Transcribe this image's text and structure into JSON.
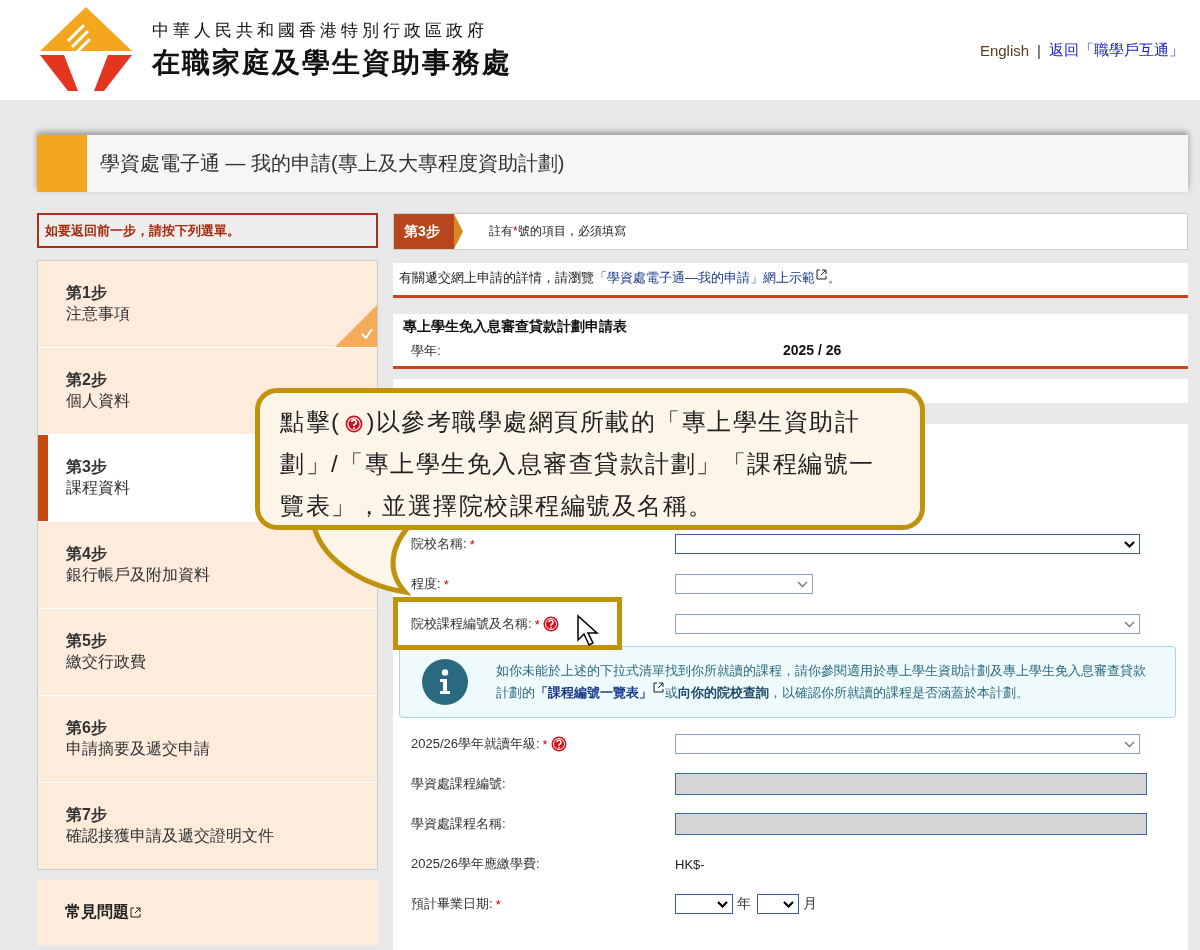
{
  "header": {
    "agency_line1": "中華人民共和國香港特別行政區政府",
    "agency_line2": "在職家庭及學生資助事務處",
    "links": [
      {
        "label": "English",
        "kind": "language"
      },
      {
        "label": "返回「職學戶互通」",
        "kind": "portal"
      }
    ],
    "separator": "|"
  },
  "page_title": "學資處電子通 — 我的申請(專上及大專程度資助計劃)",
  "sidebar": {
    "notice": "如要返回前一步，請按下列選單。",
    "steps": [
      {
        "number": "第1步",
        "title": "注意事項",
        "completed": true,
        "selected": false
      },
      {
        "number": "第2步",
        "title": "個人資料",
        "completed": false,
        "selected": false
      },
      {
        "number": "第3步",
        "title": "課程資料",
        "completed": false,
        "selected": true
      },
      {
        "number": "第4步",
        "title": "銀行帳戶及附加資料",
        "completed": false,
        "selected": false
      },
      {
        "number": "第5步",
        "title": "繳交行政費",
        "completed": false,
        "selected": false
      },
      {
        "number": "第6步",
        "title": "申請摘要及遞交申請",
        "completed": false,
        "selected": false
      },
      {
        "number": "第7步",
        "title": "確認接獲申請及遞交證明文件",
        "completed": false,
        "selected": false
      }
    ],
    "faq": "常見問題"
  },
  "step_bar": {
    "badge": "第3步",
    "note_before": "註有",
    "note_mark": "*",
    "note_after": "號的項目，必須填寫"
  },
  "info_line": {
    "before": "有關遞交網上申請的詳情，請瀏覽",
    "link": "「學資處電子通—我的申請」網上示範",
    "after": "。"
  },
  "form_header": {
    "title": "專上學生免入息審查貸款計劃申請表",
    "label": "學年:",
    "value": "2025 / 26"
  },
  "form_rows": [
    {
      "kind": "select",
      "label": "院校名稱:",
      "required_mark": "*",
      "help": false,
      "focused": true
    },
    {
      "kind": "short_select",
      "label": "程度:",
      "required_mark": "*",
      "help": false,
      "focused": false
    },
    {
      "kind": "select",
      "label": "院校課程編號及名稱:",
      "required_mark": "*",
      "help": true,
      "focused": false
    },
    {
      "kind": "info",
      "before": "如你未能於上述的下拉式清單找到你所就讀的課程，請你參閱適用於專上學生資助計劃及專上學生免入息審查貸款計劃的",
      "link": "「課程編號一覽表」",
      "after": "或**向你的院校查詢**，以確認你所就讀的課程是否涵蓋於本計劃。"
    },
    {
      "kind": "select",
      "label": "2025/26學年就讀年級:",
      "required_mark": "*",
      "help": true,
      "focused": false
    },
    {
      "kind": "readonly",
      "label": "學資處課程編號:"
    },
    {
      "kind": "readonly",
      "label": "學資處課程名稱:"
    },
    {
      "kind": "text",
      "label": "2025/26學年應繳學費:",
      "value": "HK$-"
    },
    {
      "kind": "date",
      "label": "預計畢業日期:",
      "required_mark": "*",
      "units": [
        "年",
        "月"
      ]
    }
  ],
  "callout": {
    "before": "點擊(",
    "after": ")以參考職學處網頁所載的「專上學生資助計劃」/「專上學生免入息審查貸款計劃」「課程編號一覽表」，並選擇院校課程編號及名稱。"
  }
}
